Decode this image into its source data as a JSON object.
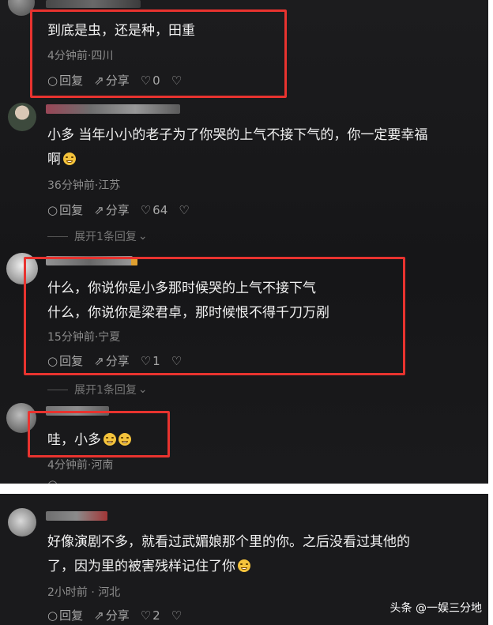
{
  "comments": [
    {
      "text_lines": [
        "到底是虫，还是种，田重"
      ],
      "meta": "4分钟前·四川",
      "reply": "回复",
      "share": "分享",
      "likes": "0"
    },
    {
      "text_lines": [
        "小多 当年小小的老子为了你哭的上气不接下气的，你一定要幸福",
        "啊"
      ],
      "meta": "36分钟前·江苏",
      "reply": "回复",
      "share": "分享",
      "likes": "64",
      "expand": "展开1条回复"
    },
    {
      "text_lines": [
        "什么，你说你是小多那时候哭的上气不接下气",
        "什么，你说你是梁君卓，那时候恨不得千刀万剐"
      ],
      "meta": "15分钟前·宁夏",
      "reply": "回复",
      "share": "分享",
      "likes": "1",
      "expand": "展开1条回复"
    },
    {
      "text_lines": [
        "哇，小多"
      ],
      "meta": "4分钟前·河南"
    },
    {
      "text_lines": [
        "好像演剧不多，就看过武媚娘那个里的你。之后没看过其他的",
        "了，因为里的被害残样记住了你"
      ],
      "meta": "2小时前 · 河北",
      "reply": "回复",
      "share": "分享",
      "likes": "2"
    }
  ],
  "watermark": "头条 @一娱三分地",
  "icons": [
    "reply-icon",
    "share-icon",
    "heart-icon",
    "dislike-icon",
    "chevron-down-icon",
    "tearful-emoji",
    "grin-emoji"
  ],
  "colors": {
    "background": "#1c1c1e",
    "highlight_box": "#e8332f",
    "text": "#f1f1f1",
    "meta": "#8d8d8d"
  }
}
